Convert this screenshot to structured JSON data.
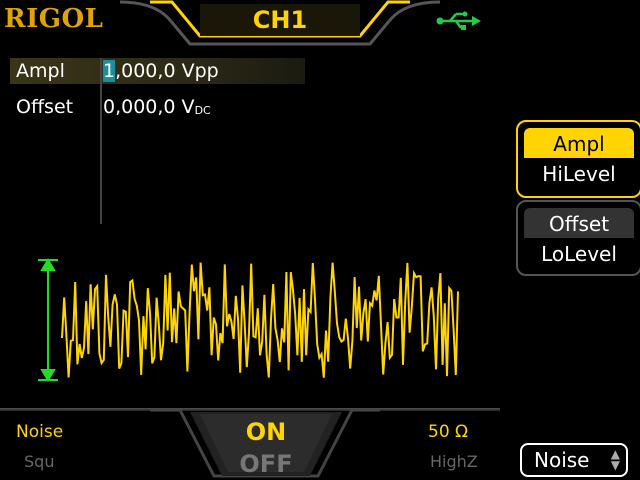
{
  "header": {
    "brand": "RIGOL",
    "channel": "CH1",
    "usb_icon": "usb-icon"
  },
  "params": [
    {
      "name": "Ampl",
      "value_cursor": "1",
      "value_rest": ",000,0 Vpp"
    },
    {
      "name": "Offset",
      "value": "0,000,0 V",
      "unit_sub": "DC"
    }
  ],
  "softkeys": {
    "ampl": {
      "top": "Ampl",
      "bottom": "HiLevel"
    },
    "offset": {
      "top": "Offset",
      "bottom": "LoLevel"
    }
  },
  "status": {
    "wave_active": "Noise",
    "wave_prev": "Squ",
    "output_on": "ON",
    "output_off": "OFF",
    "load_active": "50 Ω",
    "load_alt": "HighZ"
  },
  "bottom_button": {
    "label": "Noise"
  },
  "colors": {
    "accent": "#ffd400",
    "amplitude_marker": "#22dd22",
    "brand": "#e0a400",
    "usb": "#22cc44"
  }
}
